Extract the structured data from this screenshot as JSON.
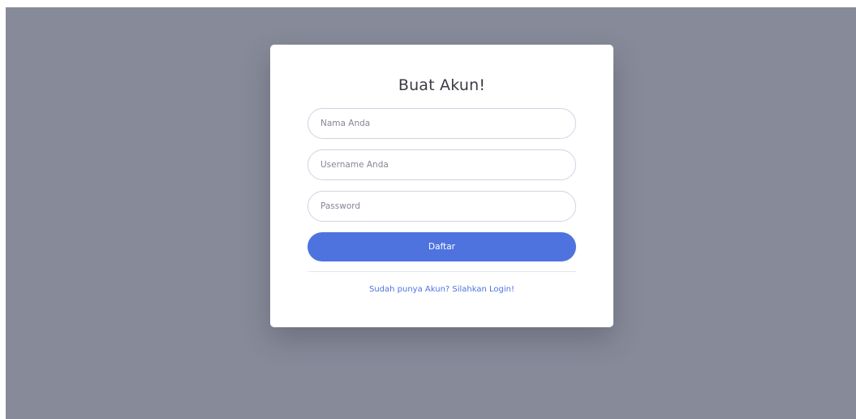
{
  "register": {
    "title": "Buat Akun!",
    "name_placeholder": "Nama Anda",
    "username_placeholder": "Username Anda",
    "password_placeholder": "Password",
    "submit_label": "Daftar",
    "login_link": "Sudah punya Akun? Silahkan Login!"
  },
  "colors": {
    "backdrop": "#878a99",
    "primary": "#4e73df",
    "input_border": "#d1d3e2"
  }
}
